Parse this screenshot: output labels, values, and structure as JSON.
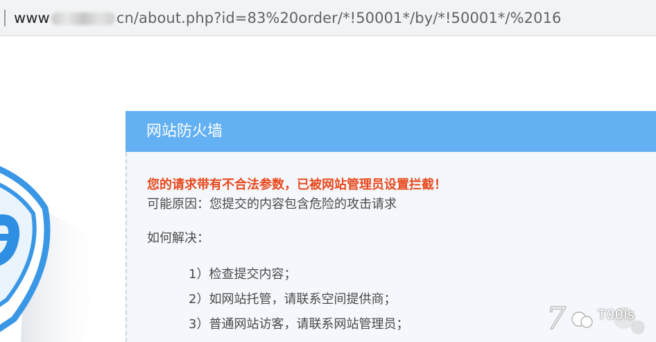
{
  "browser": {
    "url_prefix": "www",
    "url_suffix": "cn/about.php?id=83%20order/*!50001*/by/*!50001*/%2016"
  },
  "firewall": {
    "title": "网站防火墙",
    "warning": "您的请求带有不合法参数，已被网站管理员设置拦截！",
    "reason": "可能原因：您提交的内容包含危险的攻击请求",
    "howto": "如何解决：",
    "steps": [
      "1）检查提交内容；",
      "2）如网站托管，请联系空间提供商；",
      "3）普通网站访客，请联系网站管理员；"
    ]
  },
  "watermark": {
    "text": "T00ls"
  },
  "colors": {
    "header": "#63b1f2",
    "warning": "#e8491d",
    "panel_bg": "#f4f7fb"
  }
}
